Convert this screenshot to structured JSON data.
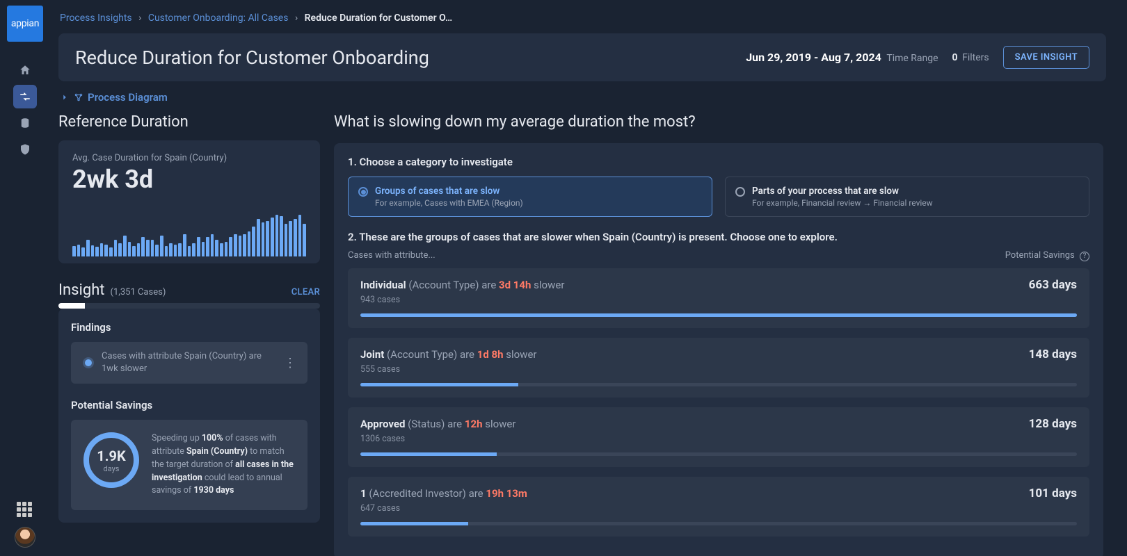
{
  "logo_text": "appian",
  "breadcrumbs": {
    "item1": "Process Insights",
    "item2": "Customer Onboarding: All Cases",
    "current": "Reduce Duration for Customer O…"
  },
  "header": {
    "title": "Reduce Duration for Customer Onboarding",
    "time_range_value": "Jun 29, 2019 - Aug 7, 2024",
    "time_range_label": "Time Range",
    "filters_count": "0",
    "filters_label": "Filters",
    "save_btn": "SAVE INSIGHT"
  },
  "process_diagram_link": "Process Diagram",
  "reference": {
    "title": "Reference Duration",
    "sub": "Avg. Case Duration for Spain (Country)",
    "value": "2wk 3d"
  },
  "chart_data": {
    "type": "bar",
    "title": "Avg. Case Duration for Spain (Country) over time",
    "xlabel": "",
    "ylabel": "",
    "values": [
      14,
      16,
      12,
      22,
      15,
      13,
      18,
      16,
      12,
      22,
      18,
      28,
      20,
      14,
      18,
      26,
      22,
      22,
      16,
      28,
      14,
      18,
      16,
      18,
      30,
      14,
      18,
      26,
      20,
      26,
      30,
      22,
      18,
      20,
      26,
      30,
      28,
      30,
      34,
      40,
      50,
      46,
      48,
      52,
      56,
      54,
      44,
      48,
      50,
      56,
      44
    ],
    "ylim": [
      0,
      60
    ]
  },
  "insight": {
    "title": "Insight",
    "count": "(1,351 Cases)",
    "clear": "CLEAR",
    "progress_pct": 10,
    "findings_title": "Findings",
    "finding_text": "Cases with attribute Spain (Country) are 1wk slower",
    "savings_title": "Potential Savings",
    "donut_value": "1.9K",
    "donut_unit": "days",
    "savings_text_pre": "Speeding up ",
    "savings_text_pct": "100%",
    "savings_text_mid1": " of cases with attribute ",
    "savings_text_attr": "Spain (Country)",
    "savings_text_mid2": " to match the target duration of ",
    "savings_text_scope": "all cases in the investigation",
    "savings_text_mid3": " could lead to annual savings of ",
    "savings_text_val": "1930 days"
  },
  "question_title": "What is slowing down my average duration the most?",
  "step1": {
    "label": "1. Choose a category to investigate",
    "opt1_title": "Groups of cases that are slow",
    "opt1_sub": "For example, Cases with EMEA (Region)",
    "opt2_title": "Parts of your process that are slow",
    "opt2_sub": "For example, Financial review → Financial review"
  },
  "step2": {
    "label": "2. These are the groups of cases that are slower when Spain (Country) is present. Choose one to explore.",
    "left_header": "Cases with attribute...",
    "right_header": "Potential Savings"
  },
  "rows": [
    {
      "bold": "Individual",
      "attr": " (Account Type) are ",
      "red": "3d 14h",
      "tail": " slower",
      "sub": "943 cases",
      "save": "663 days",
      "pct": 100
    },
    {
      "bold": "Joint",
      "attr": " (Account Type) are ",
      "red": "1d 8h",
      "tail": " slower",
      "sub": "555 cases",
      "save": "148 days",
      "pct": 22
    },
    {
      "bold": "Approved",
      "attr": " (Status) are ",
      "red": "12h",
      "tail": " slower",
      "sub": "1306 cases",
      "save": "128 days",
      "pct": 19
    },
    {
      "bold": "1",
      "attr": " (Accredited Investor) are ",
      "red": "19h 13m",
      "tail": "",
      "sub": "647 cases",
      "save": "101 days",
      "pct": 15
    }
  ]
}
